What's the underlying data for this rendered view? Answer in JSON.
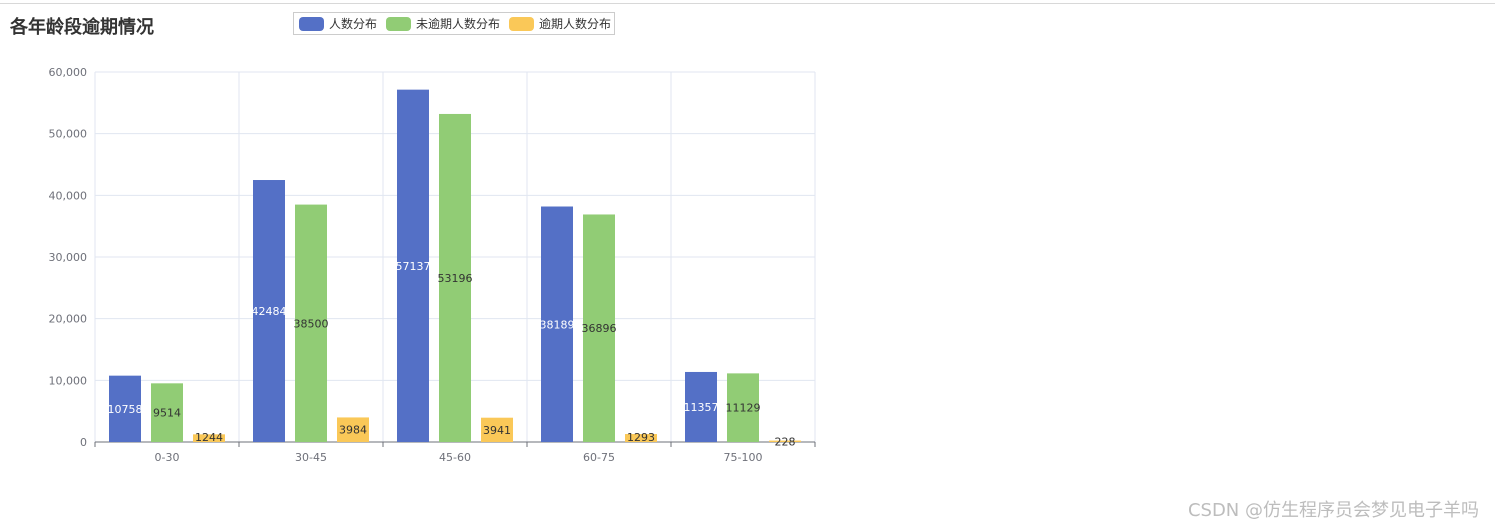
{
  "chart_data": {
    "type": "bar",
    "title": "各年龄段逾期情况",
    "categories": [
      "0-30",
      "30-45",
      "45-60",
      "60-75",
      "75-100"
    ],
    "series": [
      {
        "name": "人数分布",
        "color": "#5470c6",
        "label_color": "#ffffff",
        "values": [
          10758,
          42484,
          57137,
          38189,
          11357
        ]
      },
      {
        "name": "未逾期人数分布",
        "color": "#91cc75",
        "label_color": "#333333",
        "values": [
          9514,
          38500,
          53196,
          36896,
          11129
        ]
      },
      {
        "name": "逾期人数分布",
        "color": "#fac858",
        "label_color": "#333333",
        "values": [
          1244,
          3984,
          3941,
          1293,
          228
        ]
      }
    ],
    "ylim": [
      0,
      60000
    ],
    "yticks": [
      "0",
      "10,000",
      "20,000",
      "30,000",
      "40,000",
      "50,000",
      "60,000"
    ],
    "xlabel": "",
    "ylabel": "",
    "grid": true,
    "legend_position": "top"
  },
  "watermark": "CSDN @仿生程序员会梦见电子羊吗"
}
